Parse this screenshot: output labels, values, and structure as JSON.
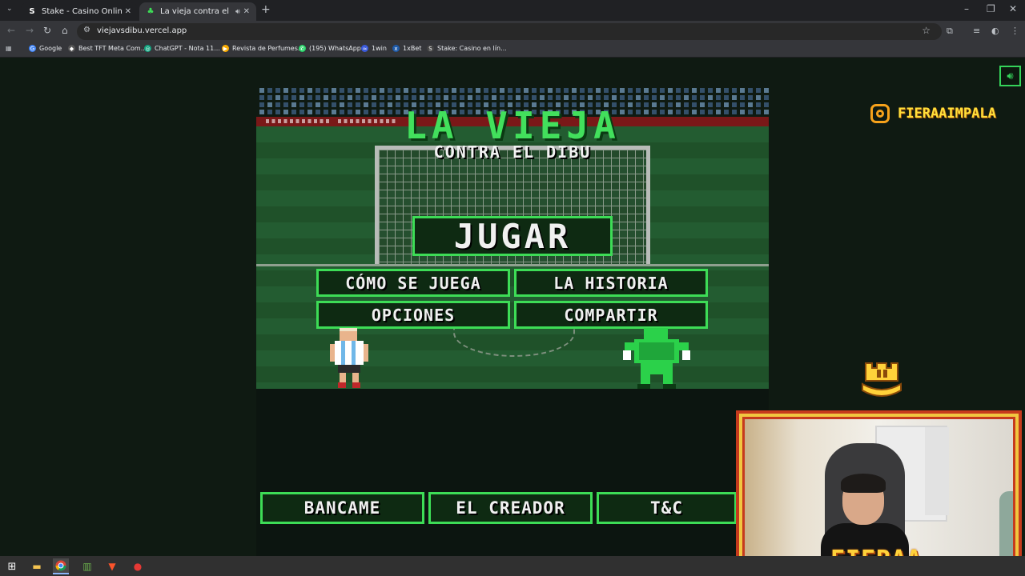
{
  "browser": {
    "tabs": [
      {
        "title": "Stake - Casino Online y Apuesta",
        "favicon": "S"
      },
      {
        "title": "La vieja contra el Dibu",
        "favicon": "♣"
      }
    ],
    "url": "viejavsdibu.vercel.app",
    "bookmarks": [
      {
        "label": "Google",
        "color": "#4285f4",
        "icon": "G"
      },
      {
        "label": "Best TFT Meta Com...",
        "color": "#555555",
        "icon": "◆"
      },
      {
        "label": "ChatGPT - Nota 11...",
        "color": "#10a37f",
        "icon": "◎"
      },
      {
        "label": "Revista de Perfumes...",
        "color": "#f9ab00",
        "icon": "▶"
      },
      {
        "label": "(195) WhatsApp",
        "color": "#25d366",
        "icon": "✆"
      },
      {
        "label": "1win",
        "color": "#3b5bdb",
        "icon": "≈"
      },
      {
        "label": "1xBet",
        "color": "#1e5aa8",
        "icon": "x"
      },
      {
        "label": "Stake: Casino en lín...",
        "color": "#444444",
        "icon": "S"
      }
    ]
  },
  "instagram": {
    "handle": "FIERAAIMPALA",
    "icon": "instagram-icon"
  },
  "game": {
    "title": "LA VIEJA",
    "subtitle": "CONTRA EL DIBU",
    "play_label": "JUGAR",
    "menu": {
      "how_to_play": "CÓMO SE JUEGA",
      "history": "LA HISTORIA",
      "options": "OPCIONES",
      "share": "COMPARTIR"
    },
    "footer": {
      "support": "BANCAME",
      "creator": "EL CREADOR",
      "terms": "T&C"
    }
  },
  "webcam": {
    "overlay_name": "FIERAA"
  },
  "colors": {
    "accent": "#3ddc56",
    "page_bg": "#0f1a12",
    "overlay_border": "#c63a1d",
    "overlay_gold": "#ffd23a"
  }
}
